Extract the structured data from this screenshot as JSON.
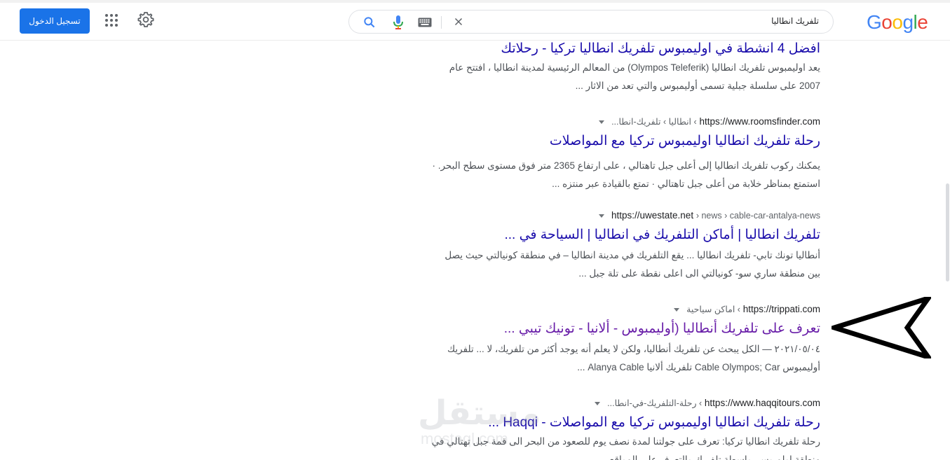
{
  "header": {
    "logo": "Google",
    "search_query": "تلفريك انطاليا",
    "signin_label": "تسجيل الدخول"
  },
  "colors": {
    "link": "#1a0dab",
    "visited": "#681da8",
    "accent": "#1a73e8"
  },
  "results": [
    {
      "title": "افضل 4 انشطة في اوليمبوس تلفريك انطاليا تركيا - رحلاتك",
      "snippet_line1": "يعد اوليمبوس تلفريك انطاليا (Olympos Teleferik) من المعالم الرئيسية لمدينة انطاليا ، افتتح عام",
      "snippet_line2": "2007 على سلسلة جبلية تسمى أوليمبوس والتي تعد من الاثار ..."
    },
    {
      "domain": "https://www.roomsfinder.com",
      "crumbs": "› انطاليا › تلفريك-انطا...",
      "title": "رحلة تلفريك انطاليا اوليمبوس تركيا مع المواصلات",
      "snippet_line1": "يمكنك ركوب تلفريك انطاليا إلى أعلى جبل تاهتالي ، على ارتفاع 2365 متر فوق مستوى سطح البحر. ·",
      "snippet_line2": "استمتع بمناظر خلابة من أعلى جبل تاهتالي · تمتع بالقيادة عبر منتزه ..."
    },
    {
      "domain": "https://uwestate.net",
      "crumbs": "› news › cable-car-antalya-news",
      "title": "تلفريك انطاليا | أماكن التلفريك في انطاليا | السياحة في ...",
      "snippet_line1": "أنطاليا تونك تابي- تلفريك انطاليا ... يقع التلفريك في مدينة انطاليا – في منطقة كونيالتي حيث يصل",
      "snippet_line2": "بين منطقة ساري سو- كونيالتي الى اعلى نقطة على تلة جبل ..."
    },
    {
      "domain": "https://trippati.com",
      "crumbs": "› اماكن سياحية",
      "title": "تعرف على تلفريك أنطاليا (أوليمبوس - ألانيا - تونيك تيبي ...",
      "snippet_line1": "٢٠٢١/٠٥/٠٤ — الكل يبحث عن تلفريك أنطاليا، ولكن لا يعلم أنه يوجد أكثر من تلفريك، لا ... تلفريك",
      "snippet_line2": "أوليمبوس Cable Olympos; Car تلفريك ألانيا Alanya Cable ..."
    },
    {
      "domain": "https://www.haqqitours.com",
      "crumbs": "› رحلة-التلفريك-في-انطا...",
      "title": "رحلة تلفريك انطاليا اوليمبوس تركيا مع المواصلات - Haqqi ...",
      "snippet_line1": "رحلة تلفريك انطاليا تركيا: تعرف على جولتنا لمدة نصف يوم للصعود من البحر الى قمة جبل تهتالي في",
      "snippet_line2": "منطقة اولمبوس بواسطة تلفريك والتعرف على المواقع ..."
    }
  ],
  "watermark": {
    "text": "مستقل",
    "url": "mostaql.com"
  }
}
